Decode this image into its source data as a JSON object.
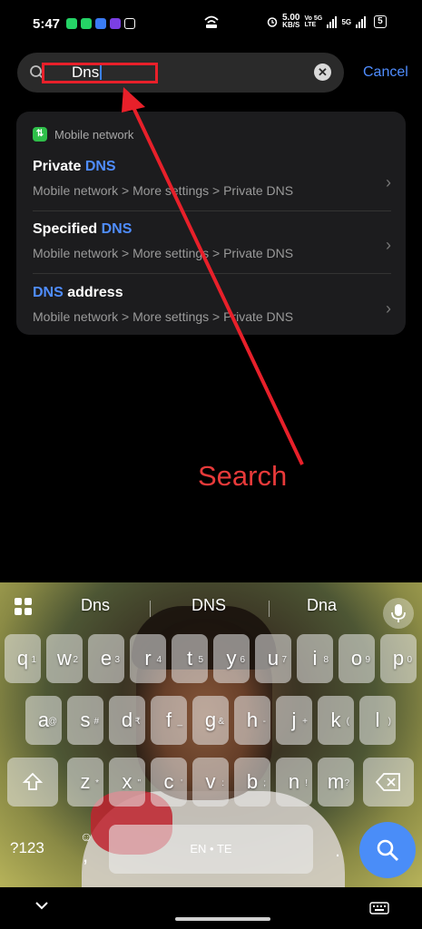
{
  "status": {
    "time": "5:47",
    "speed_value": "5.00",
    "speed_unit": "KB/S",
    "net1": "Vo 5G LTE",
    "net2": "5G",
    "battery": "5"
  },
  "search": {
    "query": "Dns",
    "cancel_label": "Cancel"
  },
  "results": {
    "group_label": "Mobile network",
    "items": [
      {
        "title_pre": "Private ",
        "title_hl": "DNS",
        "title_post": "",
        "path": "Mobile network > More settings > Private DNS"
      },
      {
        "title_pre": "Specified ",
        "title_hl": "DNS",
        "title_post": "",
        "path": "Mobile network > More settings > Private DNS"
      },
      {
        "title_pre": "",
        "title_hl": "DNS",
        "title_post": " address",
        "path": "Mobile network > More settings > Private DNS"
      }
    ]
  },
  "annotation": {
    "label": "Search",
    "color": "#e83a3a"
  },
  "keyboard": {
    "suggestions": [
      "Dns",
      "DNS",
      "Dna"
    ],
    "row1": [
      [
        "q",
        "1"
      ],
      [
        "w",
        "2"
      ],
      [
        "e",
        "3"
      ],
      [
        "r",
        "4"
      ],
      [
        "t",
        "5"
      ],
      [
        "y",
        "6"
      ],
      [
        "u",
        "7"
      ],
      [
        "i",
        "8"
      ],
      [
        "o",
        "9"
      ],
      [
        "p",
        "0"
      ]
    ],
    "row2": [
      [
        "a",
        "@"
      ],
      [
        "s",
        "#"
      ],
      [
        "d",
        "₹"
      ],
      [
        "f",
        "_"
      ],
      [
        "g",
        "&"
      ],
      [
        "h",
        "-"
      ],
      [
        "j",
        "+"
      ],
      [
        "k",
        "("
      ],
      [
        "l",
        ")"
      ]
    ],
    "row3": [
      [
        "z",
        "*"
      ],
      [
        "x",
        "\""
      ],
      [
        "c",
        "'"
      ],
      [
        "v",
        ":"
      ],
      [
        "b",
        ";"
      ],
      [
        "n",
        "!"
      ],
      [
        "m",
        "?"
      ]
    ],
    "sym_label": "?123",
    "comma": ",",
    "space_label": "EN • TE",
    "period": ".",
    "accent_color": "#4a8df8"
  }
}
